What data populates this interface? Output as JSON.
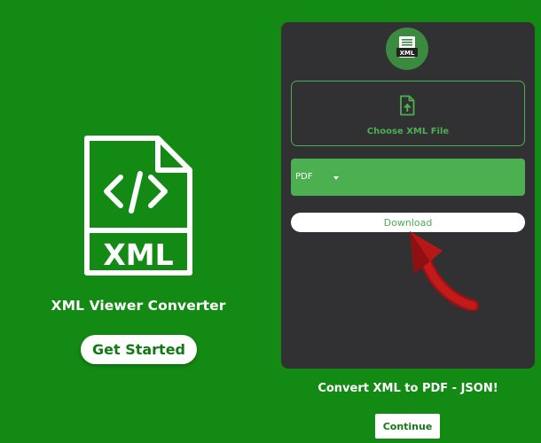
{
  "promo": {
    "file_badge": "XML",
    "app_name": "XML Viewer Converter",
    "get_started_label": "Get Started"
  },
  "app": {
    "logo_badge": "XML",
    "choose_file_label": "Choose XML File",
    "format_selected": "PDF",
    "download_label": "Download"
  },
  "footer": {
    "tagline": "Convert XML to PDF - JSON!",
    "continue_label": "Continue"
  },
  "icons": {
    "large_file": "xml-file-code-icon",
    "logo": "xml-document-icon",
    "upload": "file-upload-icon",
    "dropdown": "caret-down-icon",
    "pointer": "curved-arrow-icon"
  },
  "colors": {
    "background": "#138a13",
    "panel": "#313033",
    "accent": "#4caf50",
    "arrow": "#b01515"
  }
}
